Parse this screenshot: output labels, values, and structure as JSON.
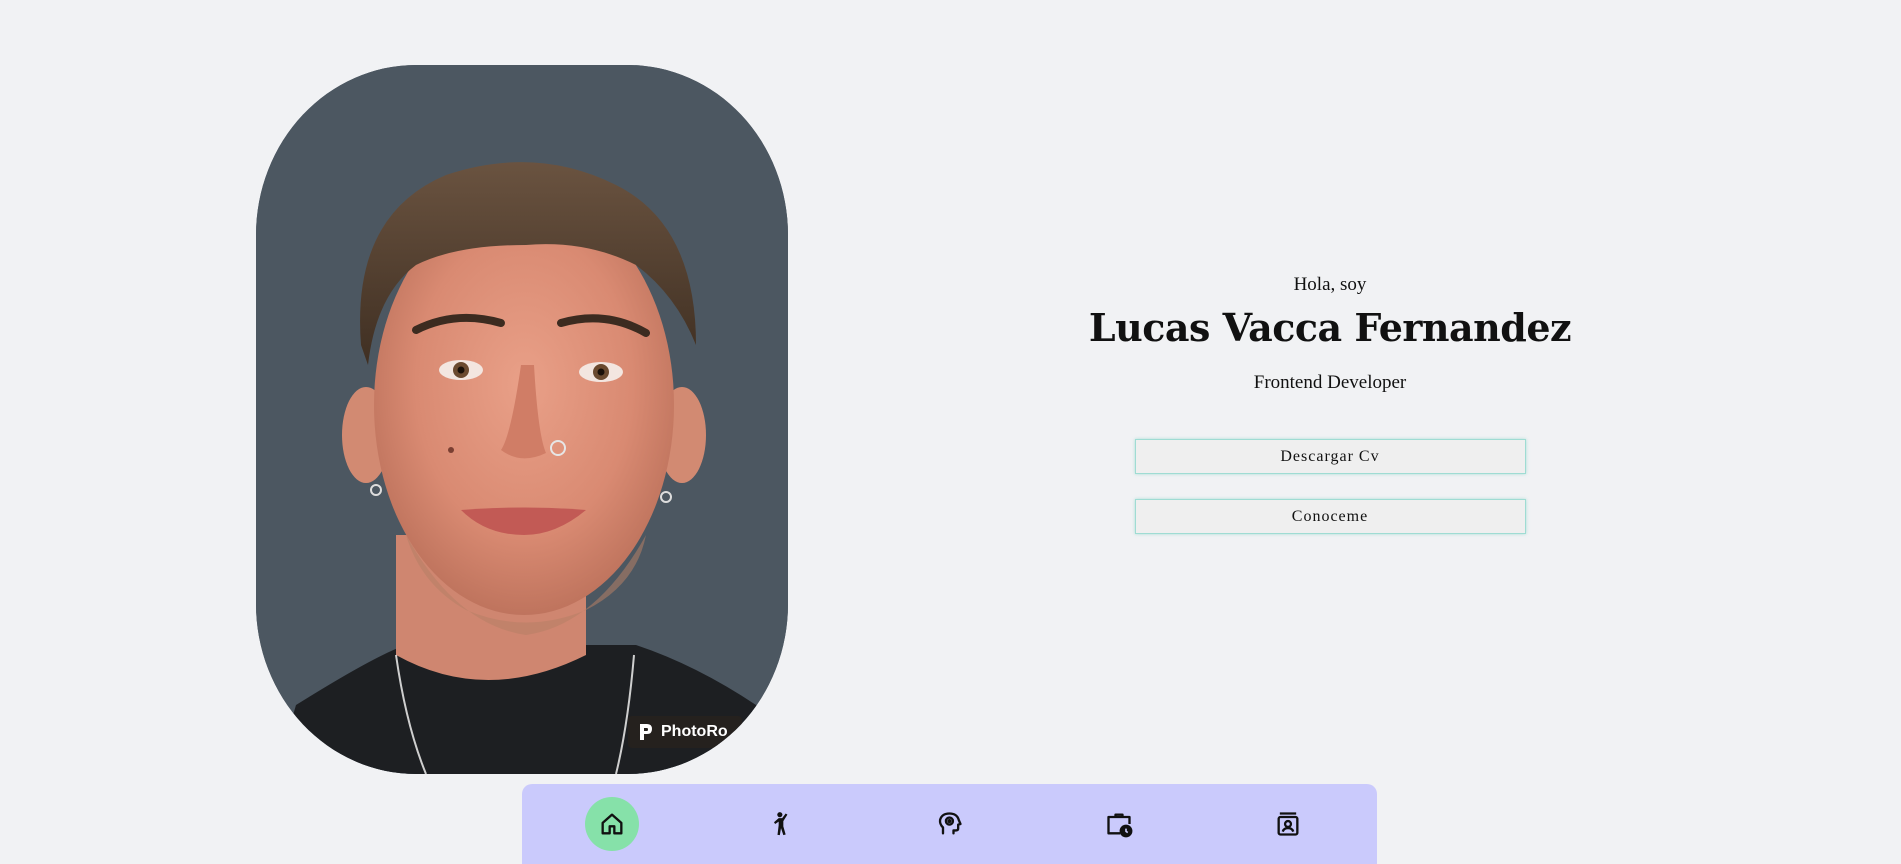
{
  "hero": {
    "greeting": "Hola, soy",
    "name": "Lucas Vacca Fernandez",
    "role": "Frontend Developer",
    "download_cv_label": "Descargar Cv",
    "know_me_label": "Conoceme"
  },
  "portrait": {
    "watermark_text": "PhotoRo"
  },
  "bottom_nav": {
    "items": [
      {
        "icon": "home-icon",
        "active": true
      },
      {
        "icon": "person-gesture-icon",
        "active": false
      },
      {
        "icon": "head-skills-icon",
        "active": false
      },
      {
        "icon": "briefcase-clock-icon",
        "active": false
      },
      {
        "icon": "contact-card-icon",
        "active": false
      }
    ]
  },
  "colors": {
    "background": "#f1f2f4",
    "portrait_bg": "#4c5761",
    "nav_bg": "#cacafc",
    "nav_active": "#86e1a9",
    "button_border": "#9fdcd3"
  }
}
